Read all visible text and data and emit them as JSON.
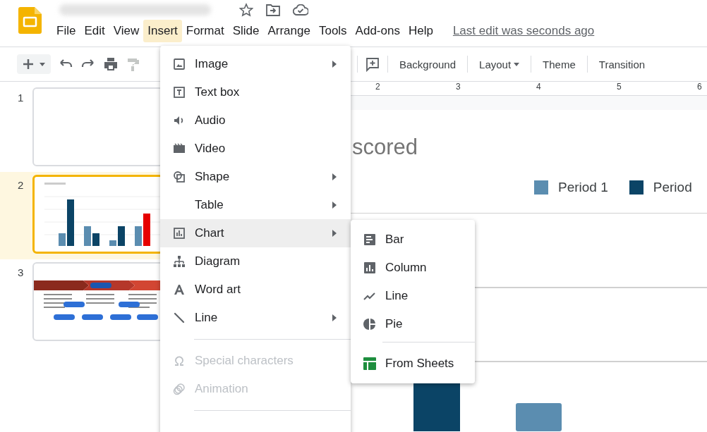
{
  "header": {
    "menus": [
      {
        "label": "File",
        "selected": false
      },
      {
        "label": "Edit",
        "selected": false
      },
      {
        "label": "View",
        "selected": false
      },
      {
        "label": "Insert",
        "selected": true
      },
      {
        "label": "Format",
        "selected": false
      },
      {
        "label": "Slide",
        "selected": false
      },
      {
        "label": "Arrange",
        "selected": false
      },
      {
        "label": "Tools",
        "selected": false
      },
      {
        "label": "Add-ons",
        "selected": false
      },
      {
        "label": "Help",
        "selected": false
      }
    ],
    "last_edit": "Last edit was seconds ago"
  },
  "toolbar": {
    "buttons": [
      {
        "label": "Background",
        "dropdown": false
      },
      {
        "label": "Layout",
        "dropdown": true
      },
      {
        "label": "Theme",
        "dropdown": false
      },
      {
        "label": "Transition",
        "dropdown": false
      }
    ]
  },
  "ruler": [
    "2",
    "3",
    "4",
    "5",
    "6"
  ],
  "slides": [
    {
      "number": "1",
      "selected": false,
      "kind": "blank"
    },
    {
      "number": "2",
      "selected": true,
      "kind": "chart"
    },
    {
      "number": "3",
      "selected": false,
      "kind": "process"
    }
  ],
  "slide": {
    "title": "scored",
    "legend": [
      {
        "label": "Period 1",
        "color": "#5b8db0"
      },
      {
        "label": "Period",
        "color": "#0b4466"
      }
    ]
  },
  "insert_menu": {
    "sections": [
      {
        "items": [
          {
            "label": "Image",
            "submenu": true,
            "expanded": false,
            "disabled": false
          },
          {
            "label": "Text box",
            "submenu": false,
            "expanded": false,
            "disabled": false
          },
          {
            "label": "Audio",
            "submenu": false,
            "expanded": false,
            "disabled": false
          },
          {
            "label": "Video",
            "submenu": false,
            "expanded": false,
            "disabled": false
          },
          {
            "label": "Shape",
            "submenu": true,
            "expanded": false,
            "disabled": false
          },
          {
            "label": "Table",
            "submenu": true,
            "expanded": false,
            "disabled": false
          },
          {
            "label": "Chart",
            "submenu": true,
            "expanded": true,
            "disabled": false
          },
          {
            "label": "Diagram",
            "submenu": false,
            "expanded": false,
            "disabled": false
          },
          {
            "label": "Word art",
            "submenu": false,
            "expanded": false,
            "disabled": false
          },
          {
            "label": "Line",
            "submenu": true,
            "expanded": false,
            "disabled": false
          }
        ]
      },
      {
        "items": [
          {
            "label": "Special characters",
            "submenu": false,
            "expanded": false,
            "disabled": true
          },
          {
            "label": "Animation",
            "submenu": false,
            "expanded": false,
            "disabled": true
          }
        ]
      }
    ]
  },
  "chart_menu": {
    "sections": [
      {
        "items": [
          {
            "label": "Bar"
          },
          {
            "label": "Column"
          },
          {
            "label": "Line"
          },
          {
            "label": "Pie"
          }
        ]
      },
      {
        "items": [
          {
            "label": "From Sheets"
          }
        ]
      }
    ]
  }
}
